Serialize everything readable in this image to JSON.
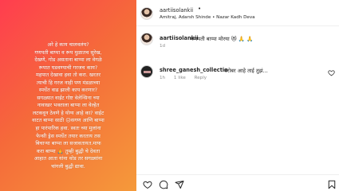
{
  "post": {
    "text_lines": [
      "अरे हे काय चालवलंय?",
      "गणपती बाप्पा व रूप मुळातच सुरेख,",
      "देखणे, गोड असताना बाप्पा ला वेगळे",
      "रूपात घडवण्याची गरजच काय?",
      "महपात देखावा हवा तो करा. खरतर",
      "त्याची हि गरज नाही पण मंडळाच्या",
      "स्पर्धेत वाढ झाली काय करणार?",
      "सगळ्यात वाईट गोष्ट वेलेन्सिना च्या",
      "नावाखर भक्ताला बाप्पा ला वेल्हेत",
      "लटकवून ठेवणे हे योग्य आहे का? वाईट",
      "वाटत बाप्पा साठी 😥सगण आणि बाप्पा",
      "हा पारंपारिक हवा. स्वतः च्या मुलांना",
      "फेन्सी ड्रेस स्पर्धेत तयार करताय तस",
      "बिचाऱ्या बाप्पा ला सजावतायत.माफ",
      "करा बाप्पा 🙏 तुम्ही बुद्धी चे देवता",
      "आहात आता यांना थोड तर सगळ्यांना",
      "चांगली बुद्धी द्यावा."
    ]
  },
  "header": {
    "username": "aartiisolankii",
    "dot": "•",
    "subtitle": "Amitraj, Adarsh Shinde • Nazar Kadh Deva"
  },
  "caption": {
    "username": "aartiisolankii",
    "text": "गणपती बाप्पा मोरया 😻 🙏 🙏",
    "time": "1d"
  },
  "comment": {
    "username": "shree_ganesh_collectio",
    "text": "बरोबर आहे ताई तुझं...",
    "time": "1h",
    "likes": "1 like",
    "reply": "Reply"
  },
  "colors": {
    "gradient_start": "#ff3d4f",
    "gradient_end": "#f59a3a",
    "text_primary": "#262626",
    "text_secondary": "#8e8e8e"
  },
  "icons": [
    "heart-icon",
    "comment-icon",
    "share-icon",
    "bookmark-icon",
    "like-outline-icon"
  ]
}
